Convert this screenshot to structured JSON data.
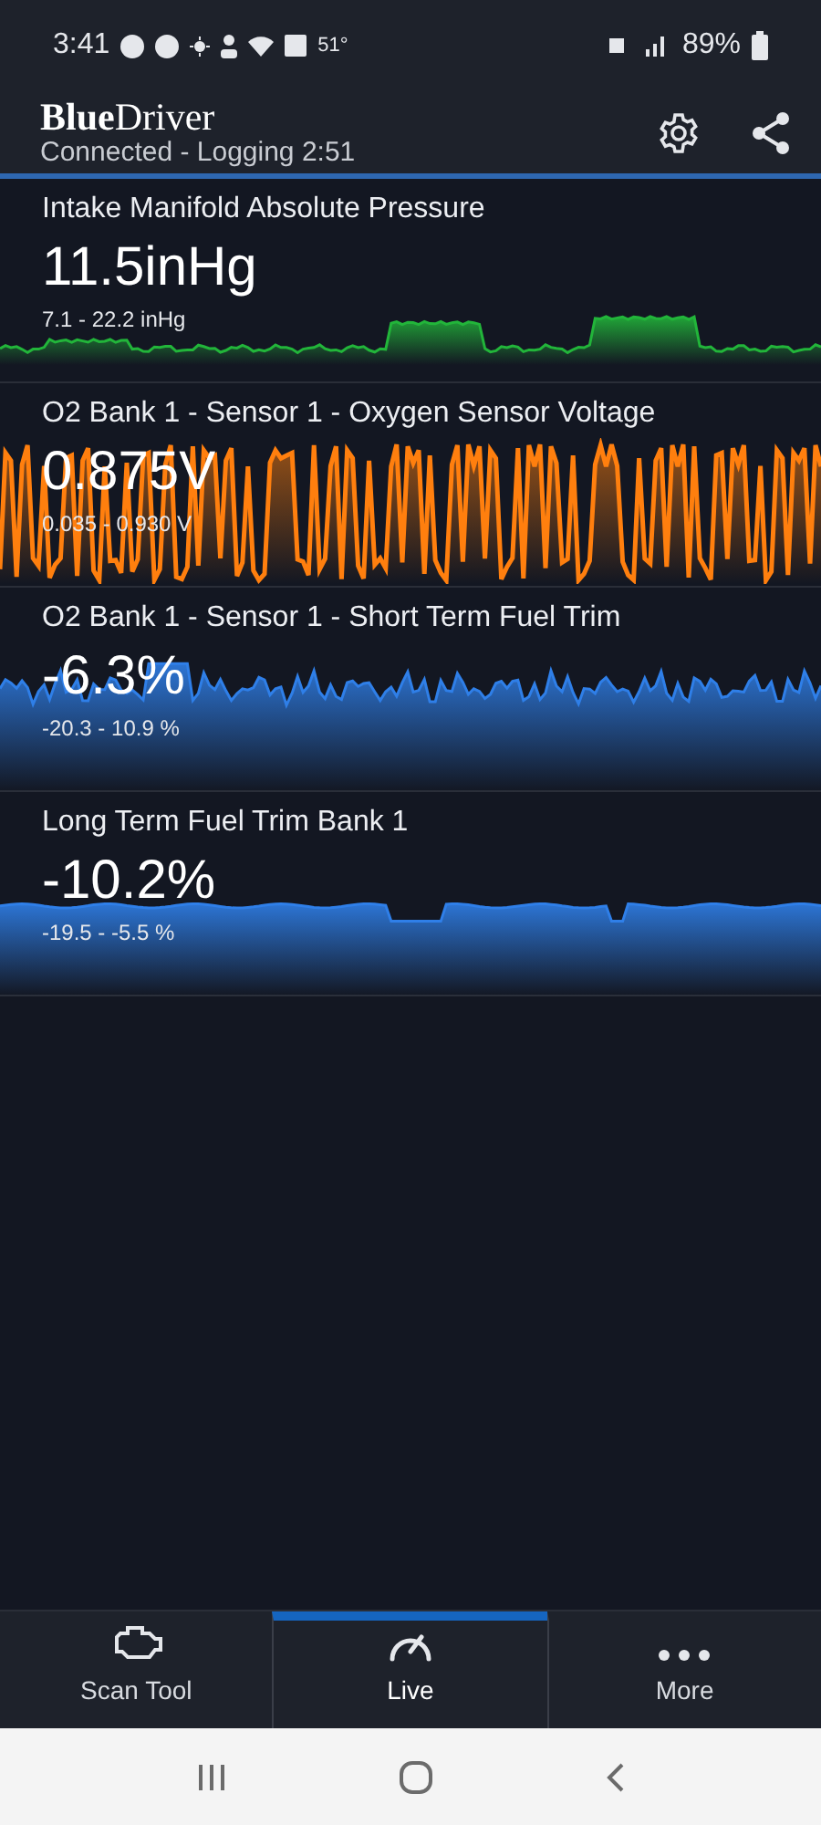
{
  "status_bar": {
    "time": "3:41",
    "temperature": "51°",
    "battery": "89%"
  },
  "header": {
    "logo": "**Blue**Driver",
    "subtitle": "Connected - Logging 2:51"
  },
  "gauges": [
    {
      "title": "Intake Manifold Absolute Pressure",
      "value": "11.5inHg",
      "range": "7.1 - 22.2 inHg",
      "color": "#22b53a",
      "kind": "steps"
    },
    {
      "title": "O2 Bank 1 - Sensor 1 - Oxygen Sensor Voltage",
      "value": "0.875V",
      "range": "0.035 - 0.930 V",
      "color": "#ff7f0e",
      "kind": "oscillating"
    },
    {
      "title": "O2 Bank 1 - Sensor 1 - Short Term Fuel Trim",
      "value": "-6.3%",
      "range": "-20.3 - 10.9 %",
      "color": "#2f7fe8",
      "kind": "noisy"
    },
    {
      "title": "Long Term Fuel Trim Bank 1",
      "value": "-10.2%",
      "range": "-19.5 - -5.5 %",
      "color": "#2f7fe8",
      "kind": "flat"
    }
  ],
  "tabs": [
    {
      "label": "Scan Tool",
      "selected": false,
      "kind": "engine"
    },
    {
      "label": "Live",
      "selected": true,
      "kind": "gauge"
    },
    {
      "label": "More",
      "selected": false,
      "kind": "dots"
    }
  ]
}
